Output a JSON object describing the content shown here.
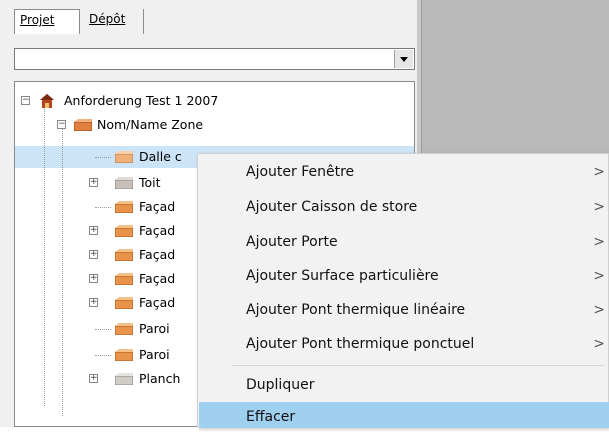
{
  "tabs": [
    {
      "label": "Projet",
      "active": true
    },
    {
      "label": "Dépôt",
      "active": false
    }
  ],
  "combo": {
    "value": ""
  },
  "tree": [
    {
      "label": "Anforderung Test 1 2007",
      "icon": "house-icon",
      "expander": "minus"
    },
    {
      "label": "Nom/Name Zone",
      "icon": "zone-block-icon",
      "expander": "minus"
    },
    {
      "label": "Dalle c",
      "icon": "floor-block-icon",
      "expander": "none",
      "selected": true
    },
    {
      "label": "Toit",
      "icon": "roof-block-icon",
      "expander": "plus"
    },
    {
      "label": "Façad",
      "icon": "facade-block-icon",
      "expander": "none"
    },
    {
      "label": "Façad",
      "icon": "facade-block-icon",
      "expander": "plus"
    },
    {
      "label": "Façad",
      "icon": "facade-block-icon",
      "expander": "plus"
    },
    {
      "label": "Façad",
      "icon": "facade-block-icon",
      "expander": "plus"
    },
    {
      "label": "Façad",
      "icon": "facade-block-icon",
      "expander": "plus"
    },
    {
      "label": "Paroi",
      "icon": "wall-block-icon",
      "expander": "none"
    },
    {
      "label": "Paroi",
      "icon": "wall-block-icon",
      "expander": "none"
    },
    {
      "label": "Planch",
      "icon": "floor-gray-block-icon",
      "expander": "plus"
    }
  ],
  "context_menu": {
    "items": [
      {
        "label": "Ajouter Fenêtre",
        "submenu": true
      },
      {
        "label": "Ajouter Caisson de store",
        "submenu": true
      },
      {
        "label": "Ajouter Porte",
        "submenu": true
      },
      {
        "label": "Ajouter Surface particulière",
        "submenu": true
      },
      {
        "label": "Ajouter Pont thermique linéaire",
        "submenu": true
      },
      {
        "label": "Ajouter Pont thermique ponctuel",
        "submenu": true
      },
      {
        "label": "Dupliquer",
        "submenu": false
      },
      {
        "label": "Effacer",
        "submenu": false,
        "highlighted": true
      }
    ],
    "submenu_arrow": ">"
  },
  "colors": {
    "selection": "#cce4f7",
    "menu_highlight": "#9fd0f0",
    "panel_gray": "#b9b9b9"
  }
}
